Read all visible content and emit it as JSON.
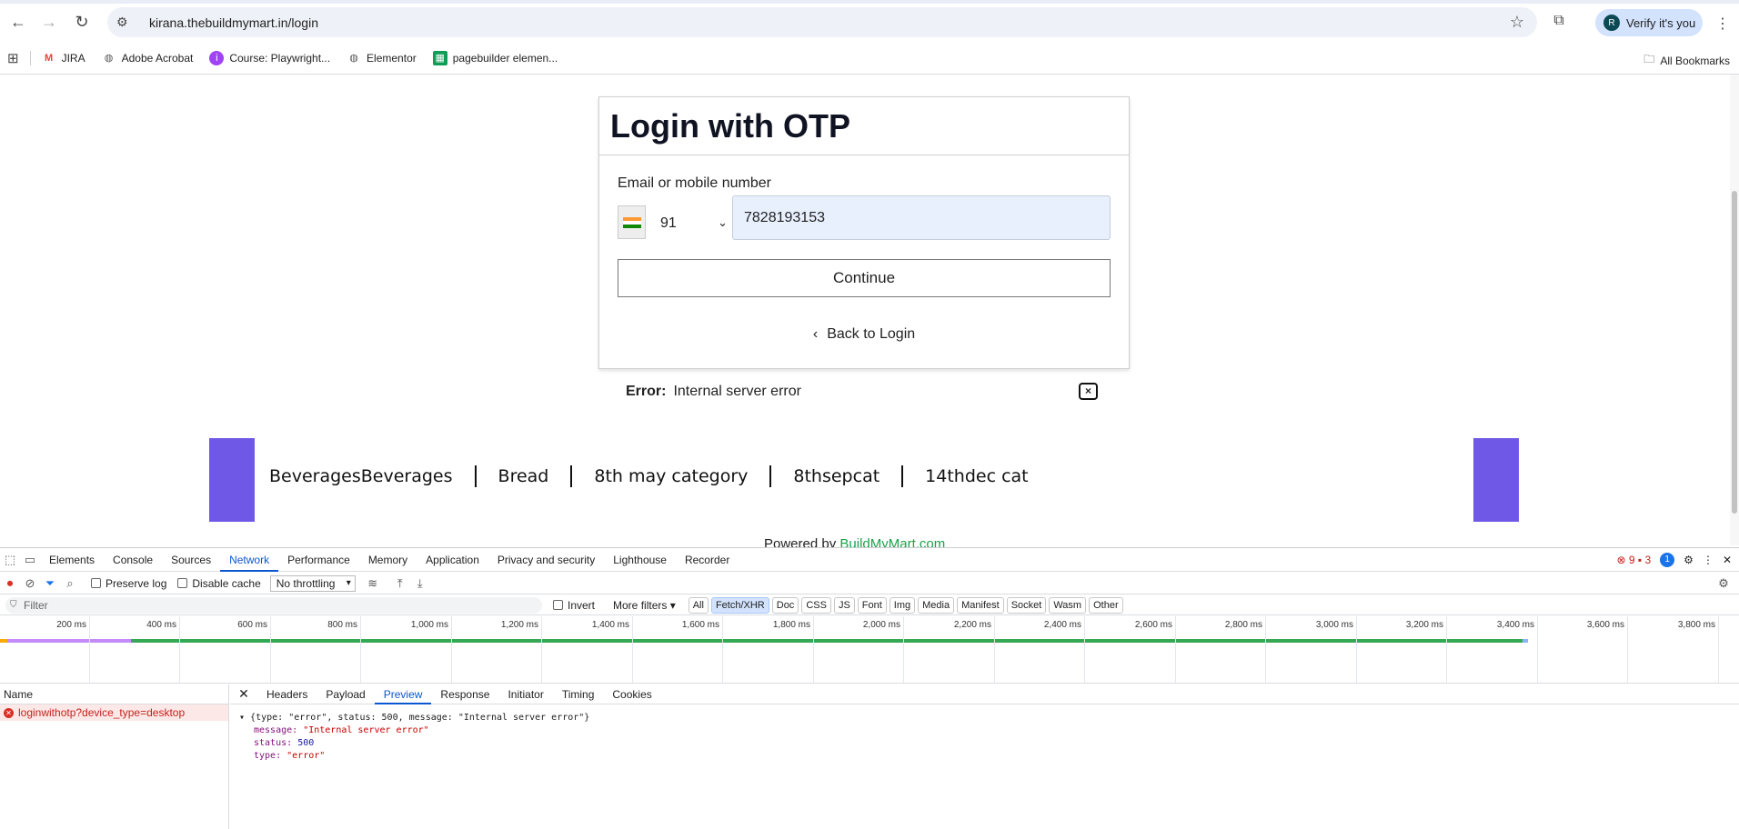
{
  "browser": {
    "url": "kirana.thebuildmymart.in/login",
    "profile_initial": "R",
    "profile_label": "Verify it's you",
    "bookmarks": [
      {
        "label": "JIRA",
        "icon": "gmail-icon",
        "color": "#ea4335"
      },
      {
        "label": "Adobe Acrobat",
        "icon": "globe-icon",
        "color": "#555555"
      },
      {
        "label": "Course: Playwright...",
        "icon": "course-icon",
        "color": "#a142f4"
      },
      {
        "label": "Elementor",
        "icon": "globe-icon",
        "color": "#555555"
      },
      {
        "label": "pagebuilder elemen...",
        "icon": "sheets-icon",
        "color": "#0f9d58"
      }
    ],
    "all_bookmarks": "All Bookmarks"
  },
  "login": {
    "title": "Login with OTP",
    "field_label": "Email or mobile number",
    "country_code": "91",
    "phone_value": "7828193153",
    "continue_label": "Continue",
    "back_label": "Back to Login"
  },
  "error": {
    "label": "Error:",
    "message": "Internal server error",
    "close": "×"
  },
  "categories": [
    "BeveragesBeverages",
    "Bread",
    "8th may category",
    "8thsepcat",
    "14thdec cat"
  ],
  "footer": {
    "powered_prefix": "Powered by ",
    "powered_brand": "BuildMyMart.com"
  },
  "devtools": {
    "tabs": [
      "Elements",
      "Console",
      "Sources",
      "Network",
      "Performance",
      "Memory",
      "Application",
      "Privacy and security",
      "Lighthouse",
      "Recorder"
    ],
    "active_tab": "Network",
    "error_count": "9",
    "warning_count": "3",
    "badge": "1",
    "preserve_log": "Preserve log",
    "disable_cache": "Disable cache",
    "throttling": "No throttling",
    "filter_placeholder": "Filter",
    "invert": "Invert",
    "more_filters": "More filters",
    "type_filters": [
      "All",
      "Fetch/XHR",
      "Doc",
      "CSS",
      "JS",
      "Font",
      "Img",
      "Media",
      "Manifest",
      "Socket",
      "Wasm",
      "Other"
    ],
    "active_filter": "Fetch/XHR",
    "ticks": [
      "200 ms",
      "400 ms",
      "600 ms",
      "800 ms",
      "1,000 ms",
      "1,200 ms",
      "1,400 ms",
      "1,600 ms",
      "1,800 ms",
      "2,000 ms",
      "2,200 ms",
      "2,400 ms",
      "2,600 ms",
      "2,800 ms",
      "3,000 ms",
      "3,200 ms",
      "3,400 ms",
      "3,600 ms",
      "3,800 ms"
    ],
    "name_header": "Name",
    "request_name": "loginwithotp?device_type=desktop",
    "detail_tabs": [
      "Headers",
      "Payload",
      "Preview",
      "Response",
      "Initiator",
      "Timing",
      "Cookies"
    ],
    "active_detail_tab": "Preview",
    "preview": {
      "summary": "{type: \"error\", status: 500, message: \"Internal server error\"}",
      "message_key": "message:",
      "message_val": "\"Internal server error\"",
      "status_key": "status:",
      "status_val": "500",
      "type_key": "type:",
      "type_val": "\"error\""
    }
  }
}
